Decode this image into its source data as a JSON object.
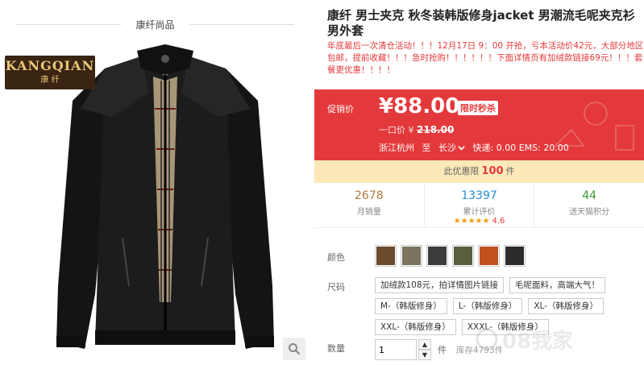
{
  "brand": {
    "header": "康纤尚品",
    "logo_en": "KANGQIAN",
    "logo_cn": "康 纤"
  },
  "product": {
    "title": "康纤 男士夹克 秋冬装韩版修身jacket 男潮流毛呢夹克衫男外套",
    "promo": "年底最后一次清仓活动！！！12月17日 9：00 开抢，亏本活动价42元，大部分地区包邮，提前收藏！！！急时抢购！！！！！！下面详情页有加绒款链接69元！！！套餐更优惠！！！！"
  },
  "price": {
    "label": "促销价",
    "current": "¥88.00",
    "tag": "限时秒杀",
    "orig_label": "一口价 ¥",
    "orig_value": "218.00",
    "ship_from": "浙江杭州",
    "ship_to_word": "至",
    "ship_dest": "长沙",
    "ship_fees": "快递: 0.00 EMS: 20.00"
  },
  "limit": {
    "prefix": "此优惠限",
    "count": "100",
    "suffix": "件"
  },
  "stats": [
    {
      "value": "2678",
      "label": "月销量",
      "color": "#b07a3c"
    },
    {
      "value": "13397",
      "label": "累计评价",
      "color": "#2a8fd6",
      "stars": "★★★★★",
      "score": "4.6"
    },
    {
      "value": "44",
      "label": "送天猫积分",
      "color": "#3a9b3a"
    }
  ],
  "options": {
    "color_label": "颜色",
    "colors": [
      "#6b4a2e",
      "#7a7460",
      "#3b3b3b",
      "#5a5e3c",
      "#c0501e",
      "#2c2c2c"
    ],
    "size_label": "尺码",
    "sizes": [
      "加绒款108元，拍详情图片链接",
      "毛呢面料，高端大气！",
      "M-（韩版修身）",
      "L-（韩版修身）",
      "XL-（韩版修身）",
      "XXL-（韩版修身）",
      "XXXL-（韩版修身）"
    ],
    "qty_label": "数量",
    "qty_value": "1",
    "qty_unit": "件",
    "stock": "库存4793件"
  },
  "watermark": "08我家"
}
